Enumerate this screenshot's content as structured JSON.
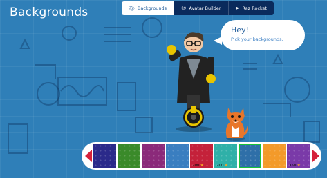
{
  "header": {
    "title": "Backgrounds"
  },
  "tabs": [
    {
      "label": "Backgrounds",
      "icon": "palette-icon",
      "active": true
    },
    {
      "label": "Avatar Builder",
      "icon": "person-icon",
      "active": false
    },
    {
      "label": "Raz Rocket",
      "icon": "rocket-icon",
      "active": false
    }
  ],
  "speech": {
    "greeting": "Hey!",
    "message": "Pick your backgrounds."
  },
  "colors": {
    "background": "#2f7fb8",
    "nav": "#0a2a5c",
    "accent": "#d6223a",
    "selected": "#19c23a",
    "star": "#f5a623"
  },
  "tiles": [
    {
      "color": "#2b2a8a",
      "price": ""
    },
    {
      "color": "#3a8a2a",
      "price": ""
    },
    {
      "color": "#8b2a7a",
      "price": ""
    },
    {
      "color": "#3a7ec0",
      "price": ""
    },
    {
      "color": "#c4213a",
      "price": "200"
    },
    {
      "color": "#2fb0a8",
      "price": "200"
    },
    {
      "color": "#2e6fa8",
      "price": "",
      "selected": true
    },
    {
      "color": "#f39a2a",
      "price": ""
    },
    {
      "color": "#7a3aa8",
      "price": "350"
    }
  ]
}
